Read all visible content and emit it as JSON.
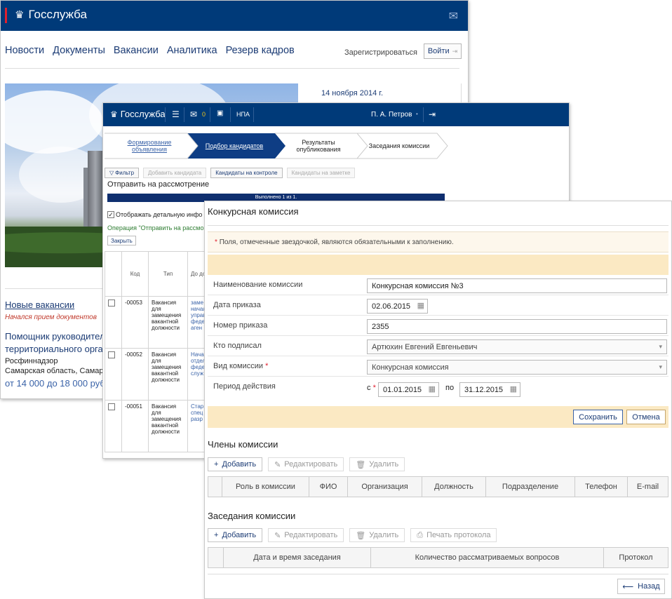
{
  "portal": {
    "brand": "Госслужба",
    "nav": [
      "Новости",
      "Документы",
      "Вакансии",
      "Аналитика",
      "Резерв кадров"
    ],
    "register": "Зарегистрироваться",
    "login": "Войти",
    "date": "14 ноября 2014 г.",
    "vacancies_title": "Новые вакансии",
    "vacancies_note": "Начался прием документов",
    "job_title": "Помощник руководителя территориального органа",
    "job_org": "Росфиннадзор",
    "job_region": "Самарская область, Самара",
    "job_salary": "от 14 000 до 18 000 руб."
  },
  "admin": {
    "brand": "Госслужба",
    "mail_count": "0",
    "npa": "НПА",
    "user": "П. А. Петров",
    "steps": [
      {
        "label": "Формирование объявления"
      },
      {
        "label": "Подбор кандидатов"
      },
      {
        "label": "Результаты опубликования"
      },
      {
        "label": "Заседания комиссии"
      }
    ],
    "buttons": [
      "Фильтр",
      "Добавить кандидата",
      "Кандидаты на контроле",
      "Кандидаты на заметке"
    ],
    "send_title": "Отправить на рассмотрение",
    "progress_text": "Выполнено 1 из 1.",
    "progress_value": 1,
    "detail_checkbox": "Отображать детальную инфо",
    "operation": "Операция \"Отправить на рассмо",
    "close": "Закрыть",
    "table": {
      "headers": [
        "",
        "Код",
        "Тип",
        "До до"
      ],
      "rows": [
        {
          "code": "-00053",
          "type": "Вакансия для замещения вакантной должности",
          "desc": "заме начал управ федер аген"
        },
        {
          "code": "-00052",
          "type": "Вакансия для замещения вакантной должности",
          "desc": "Нача отдел федер служ"
        },
        {
          "code": "-00051",
          "type": "Вакансия для замещения вакантной должности",
          "desc": "Стар спец разр"
        }
      ]
    }
  },
  "commission": {
    "title": "Конкурсная комиссия",
    "required_note": "Поля, отмеченные звездочкой, являются обязательными к заполнению.",
    "fields": {
      "name_label": "Наименование комиссии",
      "name_value": "Конкурсная комиссия №3",
      "order_date_label": "Дата приказа",
      "order_date_value": "02.06.2015",
      "order_number_label": "Номер приказа",
      "order_number_value": "2355",
      "signed_label": "Кто подписал",
      "signed_value": "Артюхин Евгений Евгеньевич",
      "type_label": "Вид комиссии",
      "type_value": "Конкурсная комиссия",
      "period_label": "Период действия",
      "from_label": "с",
      "from_value": "01.01.2015",
      "to_label": "по",
      "to_value": "31.12.2015"
    },
    "save": "Сохранить",
    "cancel": "Отмена",
    "members_title": "Члены комиссии",
    "members_buttons": {
      "add": "Добавить",
      "edit": "Редактировать",
      "delete": "Удалить"
    },
    "members_columns": [
      "",
      "Роль в комиссии",
      "ФИО",
      "Организация",
      "Должность",
      "Подразделение",
      "Телефон",
      "E-mail"
    ],
    "sessions_title": "Заседания комиссии",
    "sessions_buttons": {
      "add": "Добавить",
      "edit": "Редактировать",
      "delete": "Удалить",
      "print": "Печать протокола"
    },
    "sessions_columns": [
      "",
      "Дата и время заседания",
      "Количество рассматриваемых вопросов",
      "Протокол"
    ],
    "back": "Назад"
  }
}
